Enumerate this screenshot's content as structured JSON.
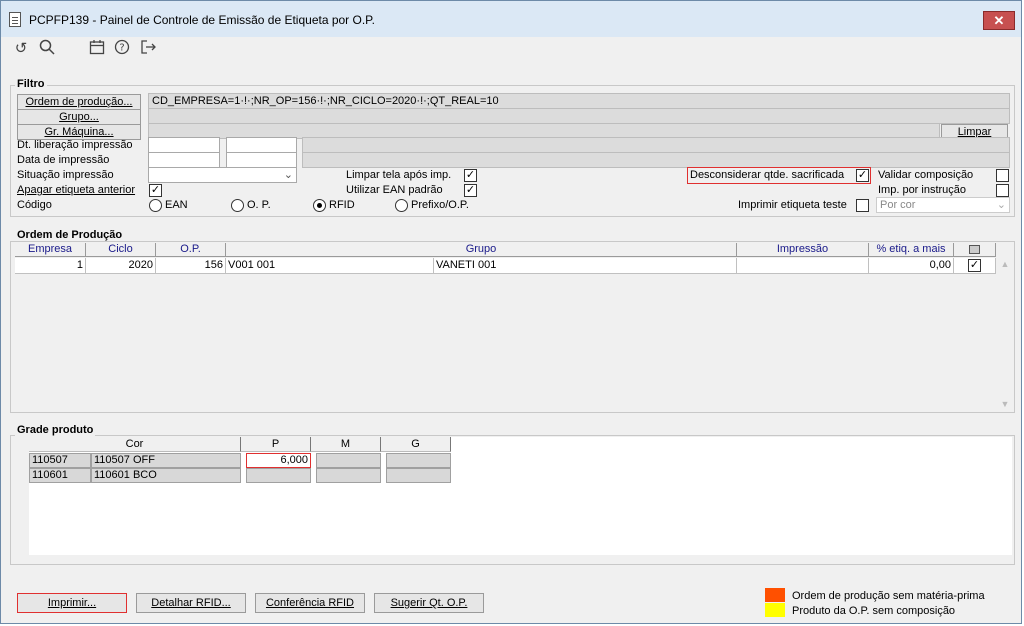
{
  "window": {
    "title": "PCPFP139 - Painel de Controle de Emissão de Etiqueta por O.P.",
    "close": "✕"
  },
  "toolbar": {
    "icons": [
      "undo-icon",
      "search-icon",
      "calendar-icon",
      "help-icon",
      "exit-icon"
    ]
  },
  "filtro": {
    "title": "Filtro",
    "ordem_btn": "Ordem de produção...",
    "grupo_btn": "Grupo...",
    "maquina_btn": "Gr. Máquina...",
    "ordem_value": "CD_EMPRESA=1·!·;NR_OP=156·!·;NR_CICLO=2020·!·;QT_REAL=10",
    "limpar_btn": "Limpar",
    "dt_liberacao": "Dt. liberação impressão",
    "data_impressao": "Data de impressão",
    "situacao": "Situação impressão",
    "apagar": "Apagar etiqueta anterior",
    "codigo": "Código",
    "limpar_tela": "Limpar tela após imp.",
    "utilizar_ean": "Utilizar EAN padrão",
    "desconsiderar": "Desconsiderar qtde. sacrificada",
    "validar": "Validar composição",
    "imp_instrucao": "Imp. por instrução",
    "imprimir_teste": "Imprimir etiqueta teste",
    "por_cor": "Por cor",
    "radios": [
      "EAN",
      "O. P.",
      "RFID",
      "Prefixo/O.P."
    ],
    "check_mark": "✓"
  },
  "ordem": {
    "title": "Ordem de Produção",
    "headers": [
      "Empresa",
      "Ciclo",
      "O.P.",
      "Grupo",
      "Impressão",
      "% etiq. a mais"
    ],
    "row": {
      "empresa": "1",
      "ciclo": "2020",
      "op": "156",
      "grupo_cod": "V001 001",
      "grupo_desc": "VANETI 001",
      "pct": "0,00"
    }
  },
  "grade": {
    "title": "Grade produto",
    "headers": [
      "Cor",
      "P",
      "M",
      "G"
    ],
    "rows": [
      {
        "cod": "110507",
        "desc": "110507 OFF",
        "p": "6,000"
      },
      {
        "cod": "110601",
        "desc": "110601 BCO",
        "p": ""
      }
    ]
  },
  "buttons": {
    "imprimir": "Imprimir...",
    "detalhar": "Detalhar RFID...",
    "conferencia": "Conferência RFID",
    "sugerir": "Sugerir Qt. O.P."
  },
  "legend": [
    {
      "color": "#ff5000",
      "text": "Ordem de produção sem matéria-prima"
    },
    {
      "color": "#ffff00",
      "text": "Produto da O.P. sem composição"
    }
  ]
}
